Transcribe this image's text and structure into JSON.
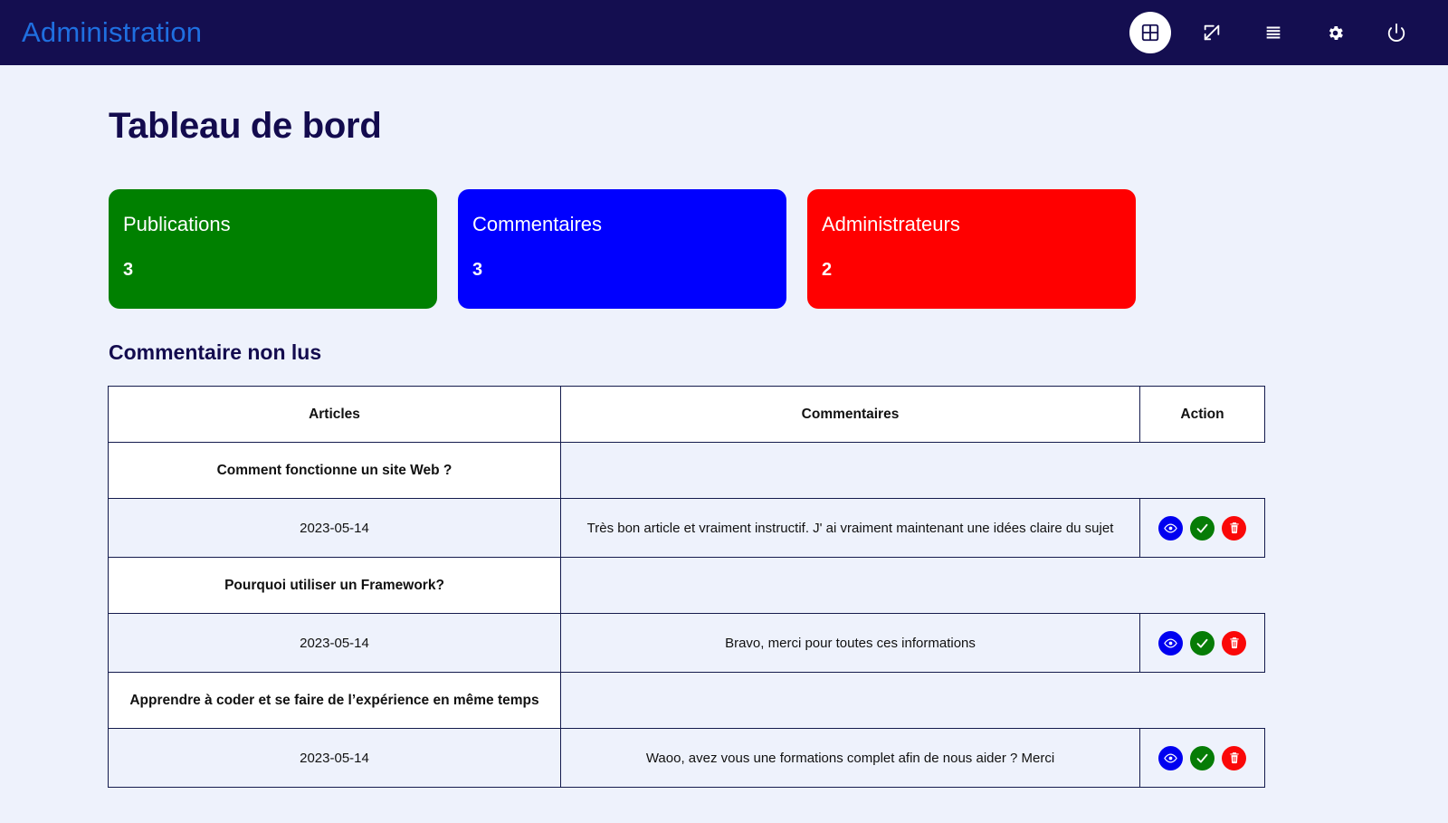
{
  "navbar": {
    "brand": "Administration",
    "brand_color": "#1f6fe0",
    "background": "#140e50",
    "icons": [
      {
        "name": "dashboard-icon",
        "label": "Tableau de bord",
        "active": true
      },
      {
        "name": "edit-icon",
        "label": "Editer",
        "active": false
      },
      {
        "name": "list-icon",
        "label": "Liste",
        "active": false
      },
      {
        "name": "gear-icon",
        "label": "Parametres",
        "active": false
      },
      {
        "name": "power-icon",
        "label": "Deconnexion",
        "active": false
      }
    ]
  },
  "page": {
    "title": "Tableau de bord",
    "section_title": "Commentaire non lus",
    "background": "#eef2fc",
    "text_color": "#130b4e"
  },
  "cards": [
    {
      "title": "Publications",
      "value": "3",
      "color": "#008000"
    },
    {
      "title": "Commentaires",
      "value": "3",
      "color": "#0000ff"
    },
    {
      "title": "Administrateurs",
      "value": "2",
      "color": "#ff0000"
    }
  ],
  "table": {
    "headers": [
      "Articles",
      "Commentaires",
      "Action"
    ],
    "groups": [
      {
        "article": "Comment fonctionne un site Web ?",
        "rows": [
          {
            "date": "2023-05-14",
            "comment": "Très bon article et vraiment instructif. J' ai vraiment maintenant une idées claire du sujet",
            "actions": [
              "view",
              "accept",
              "delete"
            ]
          }
        ]
      },
      {
        "article": "Pourquoi utiliser un Framework?",
        "rows": [
          {
            "date": "2023-05-14",
            "comment": "Bravo, merci pour toutes ces informations",
            "actions": [
              "view",
              "accept",
              "delete"
            ]
          }
        ]
      },
      {
        "article": "Apprendre à coder et se faire de l’expérience en même temps",
        "rows": [
          {
            "date": "2023-05-14",
            "comment": "Waoo, avez vous une formations complet afin de nous aider ? Merci",
            "actions": [
              "view",
              "accept",
              "delete"
            ]
          }
        ]
      }
    ],
    "action_buttons": {
      "view": {
        "icon": "eye-icon",
        "label": "Voir",
        "color": "#0000f0"
      },
      "accept": {
        "icon": "check-icon",
        "label": "Valider",
        "color": "#067c06"
      },
      "delete": {
        "icon": "trash-icon",
        "label": "Supprimer",
        "color": "#fa0808"
      }
    }
  }
}
